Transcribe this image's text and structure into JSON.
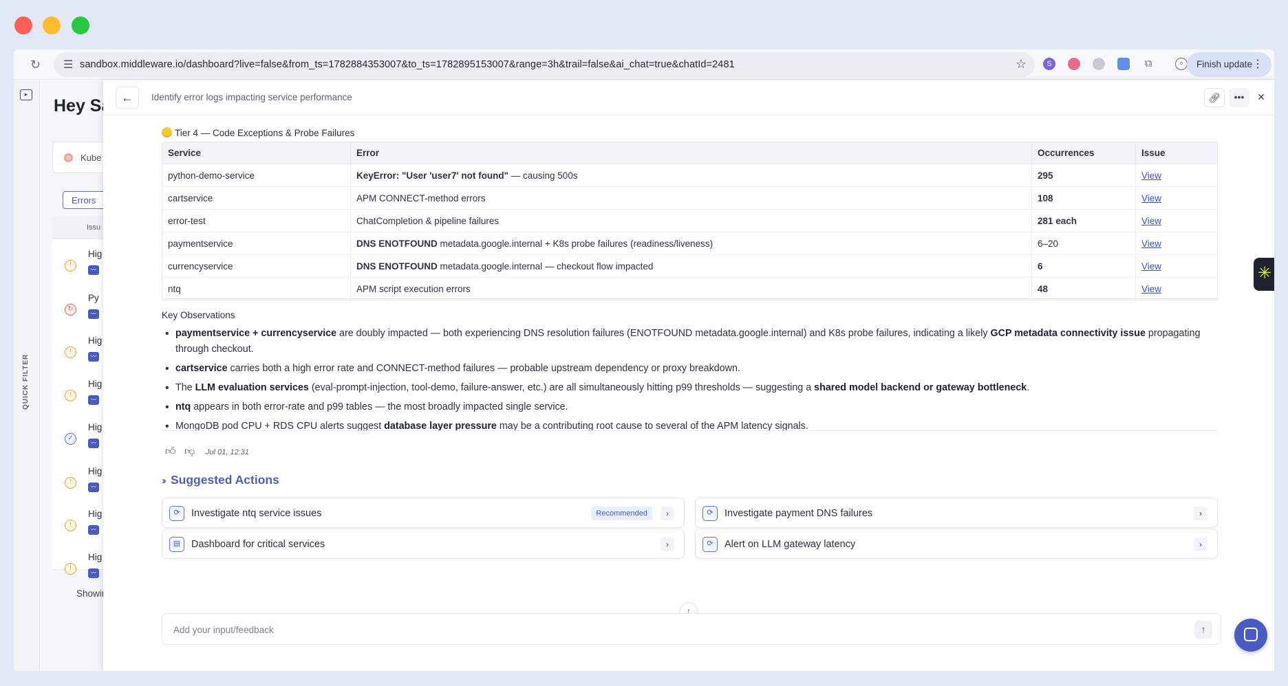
{
  "browser": {
    "url": "sandbox.middleware.io/dashboard?live=false&from_ts=1782884353007&to_ts=1782895153007&range=3h&trail=false&ai_chat=true&chatId=2481",
    "finish_update_label": "Finish update",
    "extension_badge": "S"
  },
  "bg": {
    "greeting": "Hey Sa",
    "k8s_card": "Kube",
    "errors_tab": "Errors",
    "issue_header": "Issu",
    "quick_filter": "QUICK FILTER",
    "showing": "Showing:",
    "rows": [
      {
        "name": "Hig",
        "severity": "warning"
      },
      {
        "name": "Py",
        "severity": "critical"
      },
      {
        "name": "Hig",
        "severity": "warning"
      },
      {
        "name": "Hig",
        "severity": "warning"
      },
      {
        "name": "Hig",
        "severity": "info"
      },
      {
        "name": "Hig",
        "severity": "warning"
      },
      {
        "name": "Hig",
        "severity": "warning"
      },
      {
        "name": "Hig",
        "severity": "warning"
      }
    ]
  },
  "panel": {
    "title": "Identify error logs impacting service performance",
    "tier_heading": "Tier 4 — Code Exceptions & Probe Failures",
    "table": {
      "headers": [
        "Service",
        "Error",
        "Occurrences",
        "Issue"
      ],
      "rows": [
        {
          "service": "python-demo-service",
          "error_bold": "KeyError: \"User 'user7' not found\"",
          "error_rest": " — causing 500s",
          "occurrences": "295",
          "issue": "View"
        },
        {
          "service": "cartservice",
          "error_bold": "",
          "error_rest": "APM CONNECT-method errors",
          "occurrences": "108",
          "issue": "View"
        },
        {
          "service": "error-test",
          "error_bold": "",
          "error_rest": "ChatCompletion & pipeline failures",
          "occurrences": "281 each",
          "issue": "View"
        },
        {
          "service": "paymentservice",
          "error_bold": "DNS ENOTFOUND",
          "error_rest": " metadata.google.internal + K8s probe failures (readiness/liveness)",
          "occurrences": "6–20",
          "issue": "View"
        },
        {
          "service": "currencyservice",
          "error_bold": "DNS ENOTFOUND",
          "error_rest": " metadata.google.internal — checkout flow impacted",
          "occurrences": "6",
          "issue": "View"
        },
        {
          "service": "ntq",
          "error_bold": "",
          "error_rest": "APM script execution errors",
          "occurrences": "48",
          "issue": "View"
        }
      ]
    },
    "observations_title": "Key Observations",
    "observations": [
      {
        "b1": "paymentservice + currencyservice",
        "t1": " are doubly impacted — both experiencing DNS resolution failures (ENOTFOUND metadata.google.internal) and K8s probe failures, indicating a likely ",
        "b2": "GCP metadata connectivity issue",
        "t2": " propagating through checkout."
      },
      {
        "b1": "cartservice",
        "t1": " carries both a high error rate and CONNECT-method failures — probable upstream dependency or proxy breakdown.",
        "b2": "",
        "t2": ""
      },
      {
        "pre": "The ",
        "b1": "LLM evaluation services",
        "t1": " (eval-prompt-injection, tool-demo, failure-answer, etc.) are all simultaneously hitting p99 thresholds — suggesting a ",
        "b2": "shared model backend or gateway bottleneck",
        "t2": "."
      },
      {
        "b1": "ntq",
        "t1": " appears in both error-rate and p99 tables — the most broadly impacted single service.",
        "b2": "",
        "t2": ""
      },
      {
        "pre": "MongoDB pod CPU + RDS CPU alerts suggest ",
        "b1": "database layer pressure",
        "t1": " may be a contributing root cause to several of the APM latency signals.",
        "b2": "",
        "t2": ""
      }
    ],
    "timestamp": "Jul 01, 12:31",
    "suggested_title": "Suggested Actions",
    "actions": [
      {
        "label": "Investigate ntq service issues",
        "badge": "Recommended"
      },
      {
        "label": "Investigate payment DNS failures",
        "badge": ""
      },
      {
        "label": "Dashboard for critical services",
        "badge": ""
      },
      {
        "label": "Alert on LLM gateway latency",
        "badge": ""
      }
    ],
    "input_placeholder": "Add your input/feedback"
  }
}
